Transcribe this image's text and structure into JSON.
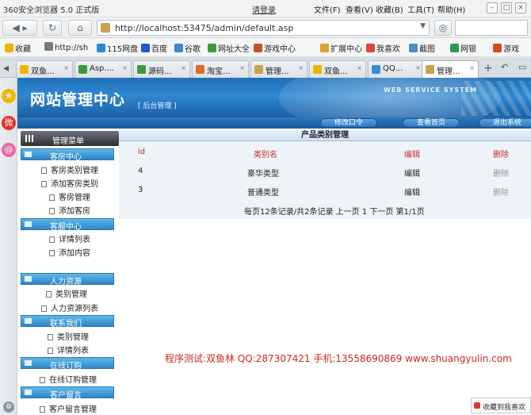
{
  "browser": {
    "title": "360安全浏览器 5.0 正式版",
    "login": "请登录",
    "menu": [
      "文件(F)",
      "查看(V)",
      "收藏(B)",
      "工具(T)",
      "帮助(H)"
    ],
    "url": "http://localhost:53475/admin/default.asp",
    "favorites": [
      "收藏",
      "http://sh",
      "115网盘",
      "百度",
      "谷歌",
      "网址大全",
      "游戏中心",
      "扩展中心",
      "我喜欢",
      "截图",
      "网银",
      "游戏"
    ],
    "tabs": [
      "双鱼...",
      "Asp....",
      "源码...",
      "淘宝...",
      "管理...",
      "双鱼...",
      "QQ...",
      "管理..."
    ],
    "active_tab_index": 7,
    "search_icon_label": "搜狗"
  },
  "site": {
    "title": "网站管理中心",
    "subtitle": "[ 后台管理 ]",
    "brand": "WEB SERVICE SYSTEM",
    "nav": [
      "修改口令",
      "查看首页",
      "退出系统"
    ]
  },
  "menu": {
    "header": "管理菜单",
    "sections": [
      {
        "title": "客房中心",
        "items": [
          "客房类别管理",
          "添加客房类别",
          "客房管理",
          "添加客房"
        ]
      },
      {
        "title": "客服中心",
        "items": [
          "详情列表",
          "添加内容"
        ]
      },
      {
        "title": "人力资源",
        "items": [
          "类别管理",
          "人力资源列表"
        ]
      },
      {
        "title": "联系我们",
        "items": [
          "类别管理",
          "详情列表"
        ]
      },
      {
        "title": "在线订购",
        "items": [
          "在线订购管理"
        ]
      },
      {
        "title": "客户留言",
        "items": [
          "客户留言管理"
        ]
      }
    ]
  },
  "main": {
    "title": "产品类别管理",
    "columns": [
      "id",
      "类别名",
      "编辑",
      "删除"
    ],
    "rows": [
      {
        "id": "4",
        "name": "豪华类型",
        "edit": "编辑",
        "delete": "删除"
      },
      {
        "id": "3",
        "name": "普通类型",
        "edit": "编辑",
        "delete": "删除"
      }
    ],
    "pager": "每页12条记录/共2条记录 上一页 1 下一页 第1/1页"
  },
  "footer_note": "程序测试:双鱼林 QQ:287307421 手机:13558690869 www.shuangyulin.com",
  "float_badge": "收藏到我喜欢",
  "colors": {
    "banner": "#2f88d0",
    "section_header": "#2c86c6",
    "table_header_text": "#c0302a",
    "footer_note": "#d0281f"
  }
}
